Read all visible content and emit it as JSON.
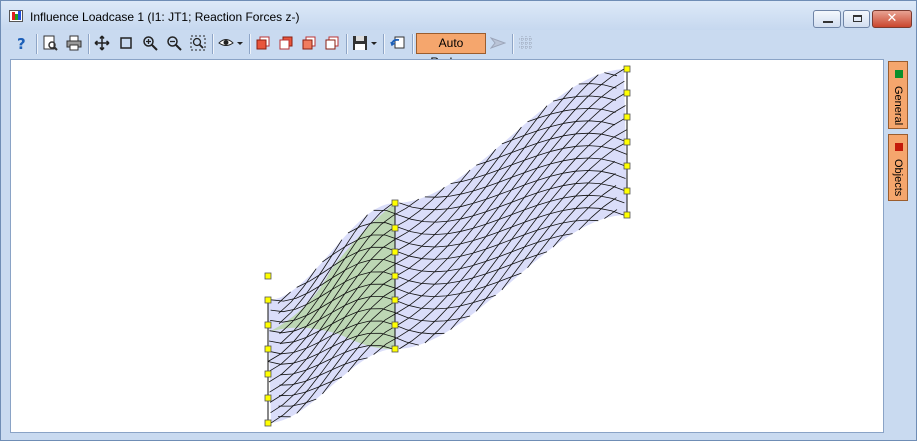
{
  "window": {
    "title": "Influence Loadcase 1 (I1: JT1; Reaction Forces z-)",
    "controls": {
      "minimize": "minimize-icon",
      "maximize": "maximize-icon",
      "close": "close-icon"
    }
  },
  "toolbar": {
    "buttons": [
      {
        "name": "help",
        "icon": "help-icon"
      },
      {
        "name": "print-preview",
        "icon": "print-preview-icon"
      },
      {
        "name": "print",
        "icon": "printer-icon"
      },
      {
        "name": "pan",
        "icon": "move-icon"
      },
      {
        "name": "select-rect",
        "icon": "rectangle-icon"
      },
      {
        "name": "zoom-in",
        "icon": "zoom-in-icon"
      },
      {
        "name": "zoom-out",
        "icon": "zoom-out-icon"
      },
      {
        "name": "zoom-extents",
        "icon": "zoom-extents-icon"
      },
      {
        "name": "view",
        "icon": "eye-icon",
        "dropdown": true
      },
      {
        "name": "view-front",
        "icon": "cube-view-icon"
      },
      {
        "name": "view-side",
        "icon": "cube-view-icon"
      },
      {
        "name": "view-top",
        "icon": "cube-view-icon"
      },
      {
        "name": "view-iso",
        "icon": "cube-view-icon"
      },
      {
        "name": "save",
        "icon": "save-icon",
        "dropdown": true
      },
      {
        "name": "undo-view",
        "icon": "undo-icon"
      }
    ],
    "auto_redraw_label": "Auto Redraw",
    "disabled_icons": [
      "arrow-icon",
      "grid-icon"
    ]
  },
  "side_tabs": [
    {
      "label": "General",
      "color": "#0a8f2a"
    },
    {
      "label": "Objects",
      "color": "#c41a0a"
    }
  ],
  "colors": {
    "accent": "#f5a66d",
    "mesh_blue": "#cdd2f7",
    "mesh_green": "#b7d6a8",
    "node": "#ffff00"
  }
}
